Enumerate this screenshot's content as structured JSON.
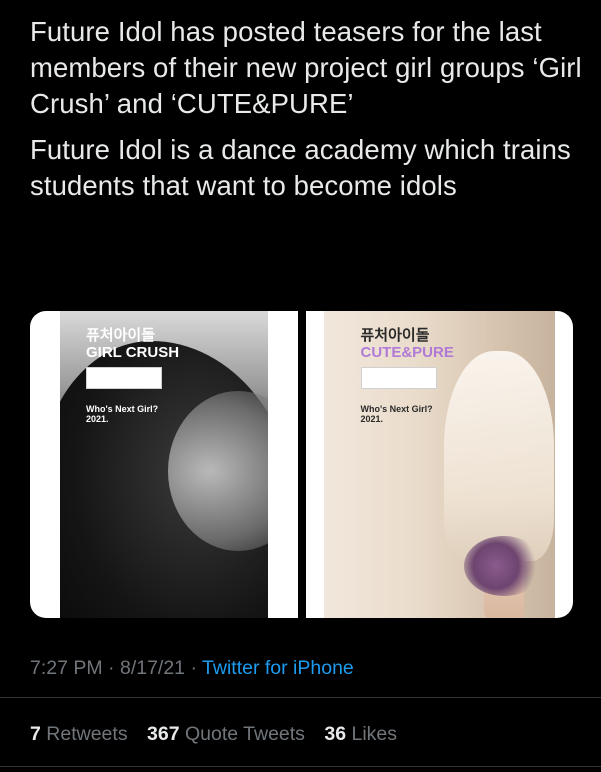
{
  "tweet": {
    "paragraphs": [
      "Future Idol has posted teasers for the last members of their new project girl groups ‘Girl Crush’ and ‘CUTE&PURE’",
      "Future Idol is a dance academy which trains students that want to become idols"
    ]
  },
  "media": [
    {
      "ko_label": "퓨처아이돌",
      "group_label": "GIRL CRUSH",
      "caption_line1": "Who's Next Girl?",
      "caption_line2": "2021.",
      "label_color": "#ffffff"
    },
    {
      "ko_label": "퓨처아이돌",
      "group_label": "CUTE&PURE",
      "caption_line1": "Who's Next Girl?",
      "caption_line2": "2021.",
      "label_color": "#b07ad6"
    }
  ],
  "meta": {
    "time": "7:27 PM",
    "separator": "·",
    "date": "8/17/21",
    "source": "Twitter for iPhone"
  },
  "stats": {
    "retweets_count": "7",
    "retweets_label": "Retweets",
    "quotes_count": "367",
    "quotes_label": "Quote Tweets",
    "likes_count": "36",
    "likes_label": "Likes"
  },
  "colors": {
    "background": "#000000",
    "text": "#e7e9ea",
    "secondary": "#71767b",
    "link": "#1d9bf0"
  }
}
